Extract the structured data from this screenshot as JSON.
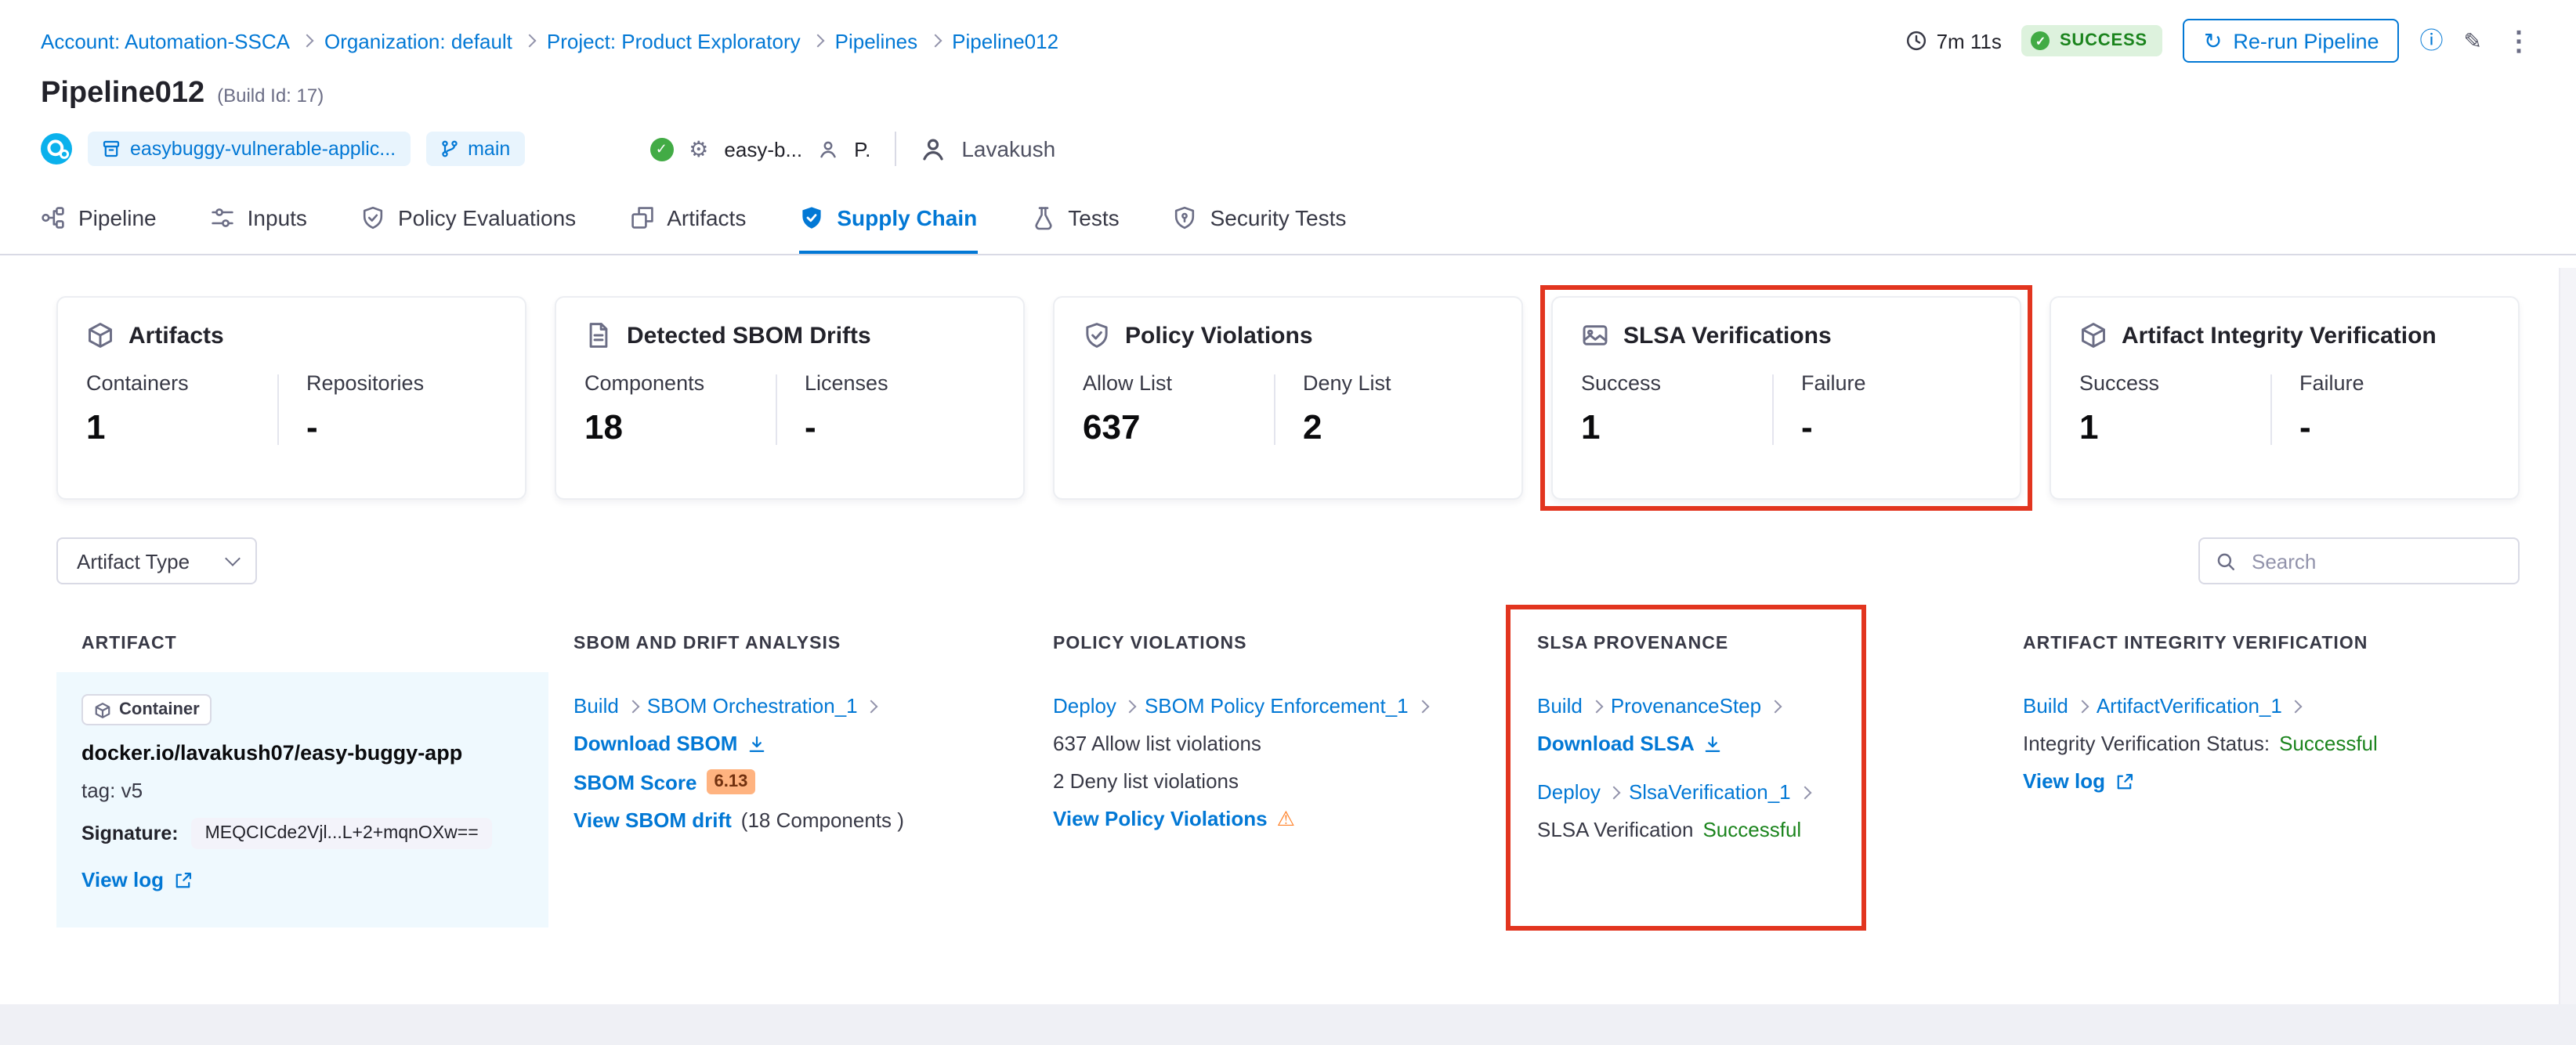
{
  "colors": {
    "accent_blue": "#0278d5",
    "success_green": "#1b841d",
    "highlight_red": "#e2351f",
    "warning_orange": "#ff832b",
    "score_badge_bg": "#ffb380",
    "artifact_cell_bg": "#eff9fe"
  },
  "icons": {
    "refresh": "↻",
    "info": "ⓘ",
    "edit": "✎",
    "more": "⋮",
    "gear": "⚙",
    "warning": "⚠",
    "check": "✓"
  },
  "breadcrumb": {
    "items": [
      "Account: Automation-SSCA",
      "Organization: default",
      "Project: Product Exploratory",
      "Pipelines",
      "Pipeline012"
    ]
  },
  "header": {
    "duration": "7m 11s",
    "status": "SUCCESS",
    "rerun_label": "Re-run Pipeline",
    "title": "Pipeline012",
    "build_id": "(Build Id: 17)",
    "repo": "easybuggy-vulnerable-applic...",
    "branch": "main",
    "trigger": "easy-b...",
    "trigger_user": "P.",
    "user": "Lavakush"
  },
  "tabs": {
    "items": [
      "Pipeline",
      "Inputs",
      "Policy Evaluations",
      "Artifacts",
      "Supply Chain",
      "Tests",
      "Security Tests"
    ],
    "active_index": 4
  },
  "cards": [
    {
      "title": "Artifacts",
      "metrics": [
        {
          "label": "Containers",
          "value": "1"
        },
        {
          "label": "Repositories",
          "value": "-"
        }
      ]
    },
    {
      "title": "Detected SBOM Drifts",
      "metrics": [
        {
          "label": "Components",
          "value": "18"
        },
        {
          "label": "Licenses",
          "value": "-"
        }
      ]
    },
    {
      "title": "Policy Violations",
      "metrics": [
        {
          "label": "Allow List",
          "value": "637"
        },
        {
          "label": "Deny List",
          "value": "2"
        }
      ]
    },
    {
      "title": "SLSA Verifications",
      "highlighted": true,
      "metrics": [
        {
          "label": "Success",
          "value": "1"
        },
        {
          "label": "Failure",
          "value": "-"
        }
      ]
    },
    {
      "title": "Artifact Integrity Verification",
      "metrics": [
        {
          "label": "Success",
          "value": "1"
        },
        {
          "label": "Failure",
          "value": "-"
        }
      ]
    }
  ],
  "filters": {
    "artifact_type_label": "Artifact Type",
    "search_placeholder": "Search"
  },
  "table": {
    "headers": [
      "ARTIFACT",
      "SBOM AND DRIFT ANALYSIS",
      "POLICY VIOLATIONS",
      "SLSA PROVENANCE",
      "ARTIFACT INTEGRITY VERIFICATION"
    ],
    "row": {
      "artifact": {
        "type": "Container",
        "name": "docker.io/lavakush07/easy-buggy-app",
        "tag": "tag: v5",
        "signature_label": "Signature:",
        "signature_value": "MEQCICde2Vjl...L+2+mqnOXw==",
        "view_log": "View log"
      },
      "sbom": {
        "stage": "Build",
        "step": "SBOM Orchestration_1",
        "download": "Download SBOM",
        "score_label": "SBOM Score",
        "score": "6.13",
        "drift_link": "View SBOM drift",
        "drift_detail": "(18 Components )"
      },
      "policy": {
        "stage": "Deploy",
        "step": "SBOM Policy Enforcement_1",
        "allow": "637 Allow list violations",
        "deny": "2 Deny list violations",
        "view": "View Policy Violations"
      },
      "slsa": {
        "build_stage": "Build",
        "build_step": "ProvenanceStep",
        "download": "Download SLSA",
        "deploy_stage": "Deploy",
        "deploy_step": "SlsaVerification_1",
        "status_label": "SLSA Verification",
        "status_value": "Successful"
      },
      "integrity": {
        "stage": "Build",
        "step": "ArtifactVerification_1",
        "status_label": "Integrity Verification Status:",
        "status_value": "Successful",
        "view_log": "View log"
      }
    }
  }
}
